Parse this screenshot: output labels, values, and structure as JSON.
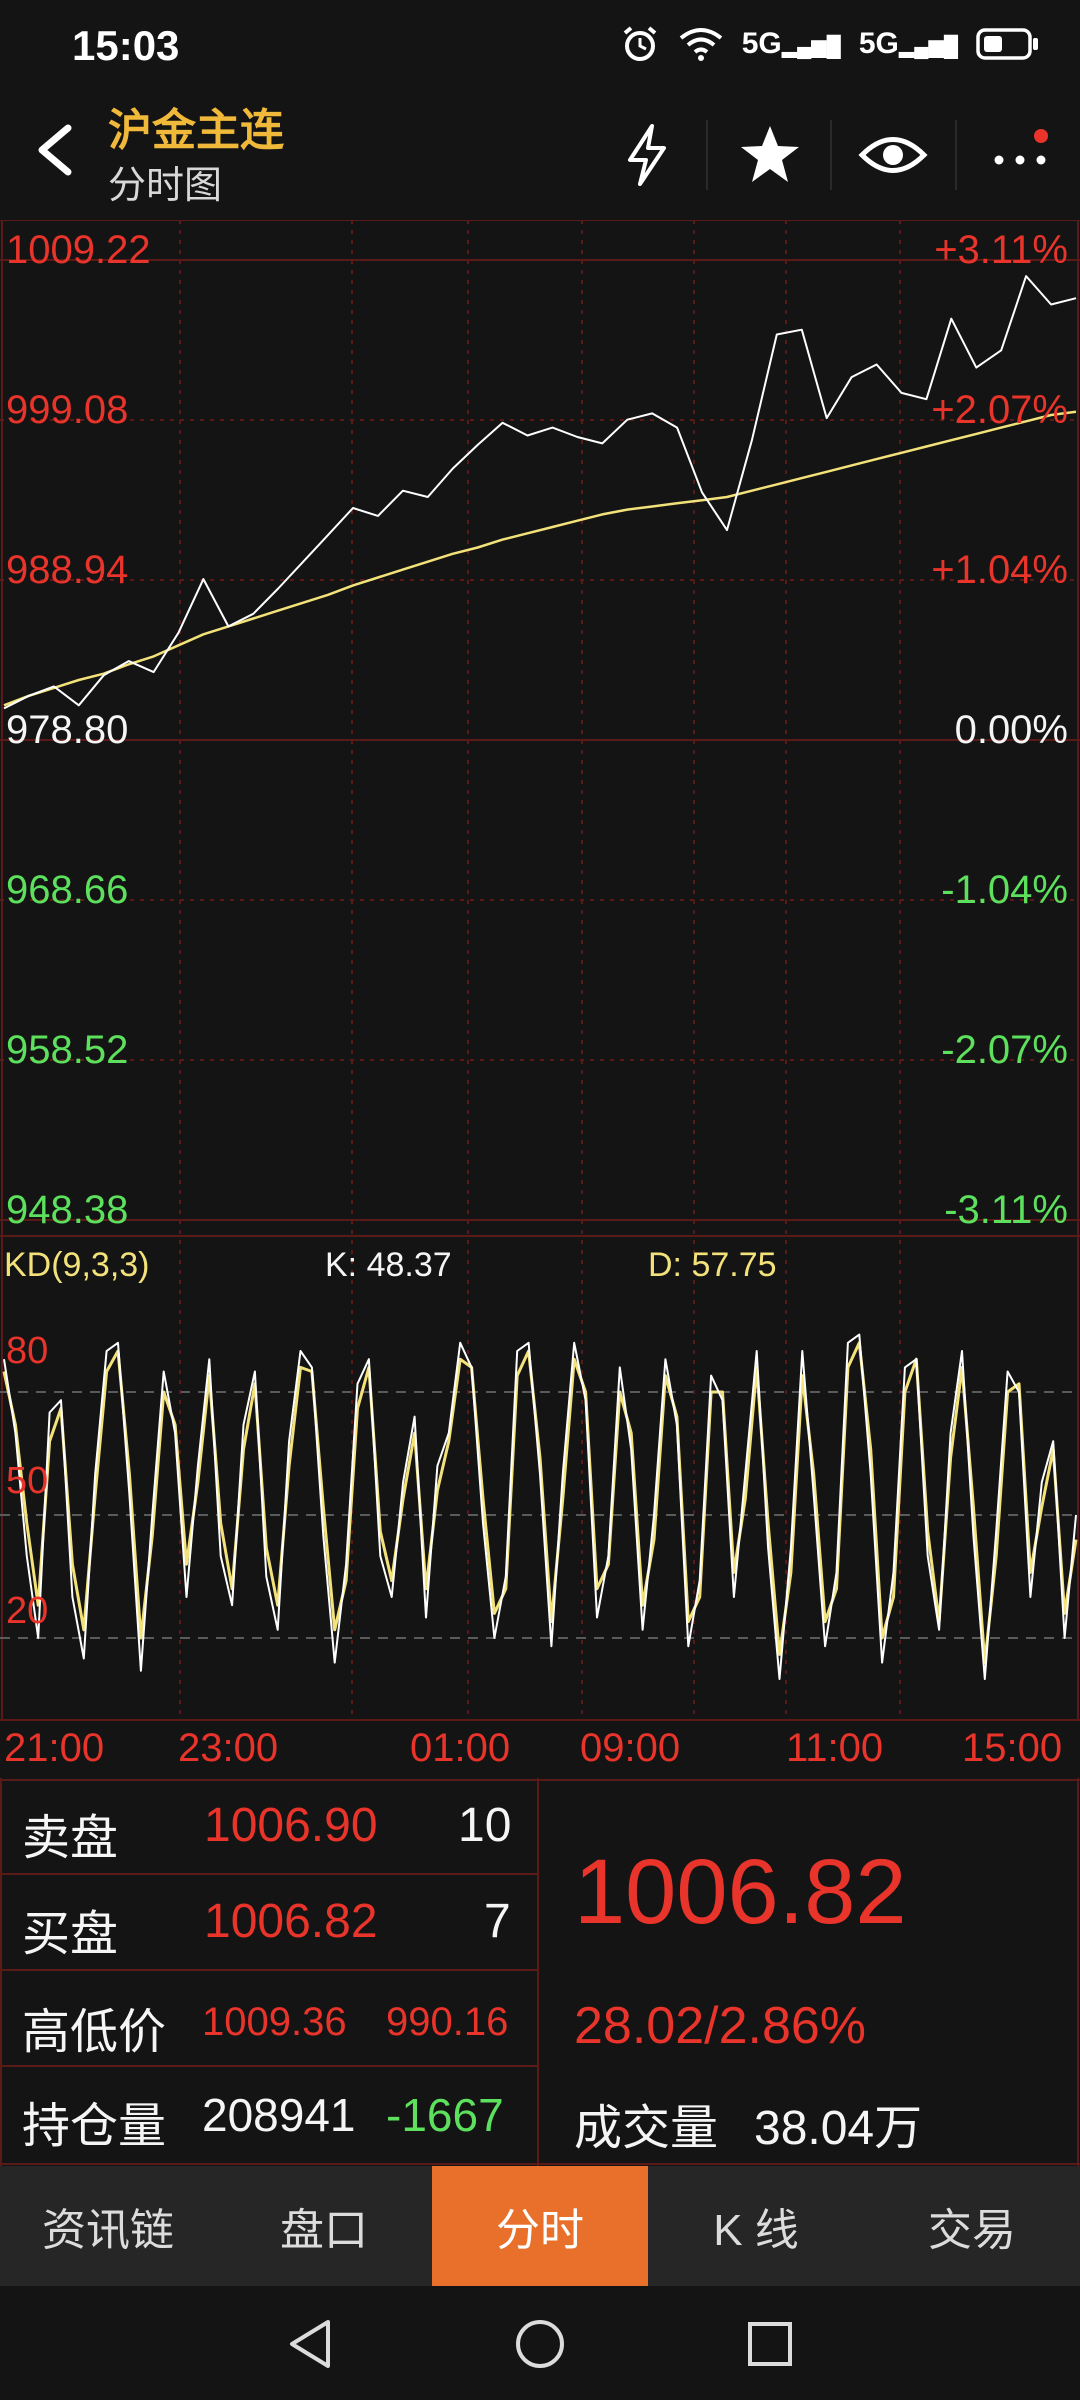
{
  "status_bar": {
    "time": "15:03",
    "icons": [
      "alarm-icon",
      "wifi-icon",
      "5g-signal-icon",
      "5g-signal-icon",
      "battery-icon"
    ],
    "signal_label": "5G"
  },
  "header": {
    "title": "沪金主连",
    "subtitle": "分时图",
    "actions": [
      "flash-icon",
      "star-icon",
      "eye-icon",
      "more-icon"
    ],
    "title_color": "#f0b93a",
    "notification_dot_color": "#e8342a"
  },
  "price_axis": {
    "left": [
      {
        "value": "1009.22",
        "color": "#e8342a"
      },
      {
        "value": "999.08",
        "color": "#e8342a"
      },
      {
        "value": "988.94",
        "color": "#e8342a"
      },
      {
        "value": "978.80",
        "color": "#f5f5f5"
      },
      {
        "value": "968.66",
        "color": "#5de05d"
      },
      {
        "value": "958.52",
        "color": "#5de05d"
      },
      {
        "value": "948.38",
        "color": "#5de05d"
      }
    ],
    "right": [
      {
        "value": "+3.11%",
        "color": "#e8342a"
      },
      {
        "value": "+2.07%",
        "color": "#e8342a"
      },
      {
        "value": "+1.04%",
        "color": "#e8342a"
      },
      {
        "value": "0.00%",
        "color": "#f5f5f5"
      },
      {
        "value": "-1.04%",
        "color": "#5de05d"
      },
      {
        "value": "-2.07%",
        "color": "#5de05d"
      },
      {
        "value": "-3.11%",
        "color": "#5de05d"
      }
    ]
  },
  "kd": {
    "label": "KD(9,3,3)",
    "k_label": "K: 48.37",
    "d_label": "D: 57.75",
    "levels": [
      "80",
      "50",
      "20"
    ]
  },
  "time_axis": [
    "21:00",
    "23:00",
    "01:00",
    "09:00",
    "11:00",
    "15:00"
  ],
  "chart_data": [
    {
      "type": "line",
      "title": "",
      "ylim": [
        948.38,
        1009.22
      ],
      "x_ticks": [
        "21:00",
        "23:00",
        "01:00",
        "09:00",
        "11:00",
        "15:00"
      ],
      "series": [
        {
          "color": "#ffffff",
          "values": [
            980.8,
            981.6,
            982.2,
            981.0,
            982.9,
            983.8,
            983.1,
            985.6,
            989.0,
            986.0,
            986.8,
            988.4,
            990.1,
            991.8,
            993.5,
            993.0,
            994.6,
            994.2,
            996.0,
            997.5,
            998.9,
            998.1,
            998.6,
            998.0,
            997.6,
            999.1,
            999.5,
            998.6,
            994.5,
            992.1,
            997.8,
            1004.5,
            1004.8,
            999.2,
            1001.8,
            1002.6,
            1000.8,
            1000.4,
            1005.5,
            1002.4,
            1003.5,
            1008.2,
            1006.4,
            1006.8
          ]
        },
        {
          "color": "#f3e27a",
          "values": [
            981.0,
            981.6,
            982.1,
            982.6,
            983.0,
            983.6,
            984.1,
            984.8,
            985.5,
            986.0,
            986.5,
            987.0,
            987.5,
            988.0,
            988.6,
            989.1,
            989.6,
            990.1,
            990.6,
            991.0,
            991.5,
            991.9,
            992.3,
            992.7,
            993.1,
            993.4,
            993.6,
            993.8,
            994.0,
            994.2,
            994.6,
            995.0,
            995.4,
            995.8,
            996.2,
            996.6,
            997.0,
            997.4,
            997.8,
            998.2,
            998.6,
            999.0,
            999.4,
            999.6
          ]
        }
      ]
    },
    {
      "type": "line",
      "title": "",
      "ylim": [
        0,
        100
      ],
      "series": [
        {
          "color": "#ffffff",
          "values": [
            88,
            70,
            40,
            20,
            75,
            78,
            30,
            15,
            60,
            90,
            92,
            55,
            12,
            50,
            85,
            70,
            30,
            62,
            88,
            40,
            28,
            72,
            85,
            35,
            22,
            68,
            90,
            86,
            45,
            14,
            38,
            82,
            88,
            40,
            30,
            58,
            74,
            25,
            62,
            70,
            92,
            86,
            48,
            20,
            35,
            90,
            92,
            60,
            18,
            60,
            92,
            78,
            25,
            40,
            86,
            66,
            22,
            50,
            88,
            72,
            18,
            34,
            84,
            78,
            30,
            60,
            90,
            42,
            10,
            42,
            90,
            55,
            18,
            36,
            92,
            94,
            60,
            14,
            36,
            86,
            88,
            40,
            22,
            70,
            90,
            45,
            10,
            46,
            85,
            80,
            30,
            58,
            68,
            20,
            50
          ]
        },
        {
          "color": "#f3e27a",
          "values": [
            85,
            72,
            48,
            28,
            68,
            76,
            38,
            22,
            55,
            85,
            90,
            60,
            20,
            45,
            80,
            72,
            38,
            58,
            84,
            48,
            32,
            66,
            82,
            42,
            28,
            62,
            86,
            85,
            52,
            22,
            34,
            76,
            86,
            46,
            34,
            54,
            70,
            32,
            56,
            68,
            88,
            86,
            54,
            26,
            32,
            84,
            90,
            64,
            24,
            54,
            88,
            80,
            32,
            38,
            80,
            70,
            28,
            44,
            84,
            74,
            24,
            30,
            80,
            80,
            36,
            54,
            86,
            48,
            16,
            36,
            84,
            60,
            24,
            32,
            86,
            92,
            66,
            20,
            30,
            80,
            88,
            46,
            24,
            64,
            86,
            52,
            14,
            40,
            80,
            82,
            36,
            52,
            66,
            26,
            44
          ]
        }
      ]
    }
  ],
  "quote": {
    "sell_label": "卖盘",
    "sell_price": "1006.90",
    "sell_qty": "10",
    "buy_label": "买盘",
    "buy_price": "1006.82",
    "buy_qty": "7",
    "hl_label": "高低价",
    "high": "1009.36",
    "low": "990.16",
    "oi_label": "持仓量",
    "oi_value": "208941",
    "oi_change": "-1667",
    "last_price": "1006.82",
    "change": "28.02/2.86%",
    "vol_label": "成交量",
    "vol_value": "38.04万"
  },
  "tabs": [
    {
      "label": "资讯链",
      "active": false
    },
    {
      "label": "盘口",
      "active": false
    },
    {
      "label": "分时",
      "active": true
    },
    {
      "label": "K 线",
      "active": false
    },
    {
      "label": "交易",
      "active": false
    }
  ],
  "colors": {
    "up": "#e8342a",
    "down": "#5de05d",
    "grid": "#5a1a18",
    "accent_tab": "#e8702b",
    "background": "#141414"
  }
}
